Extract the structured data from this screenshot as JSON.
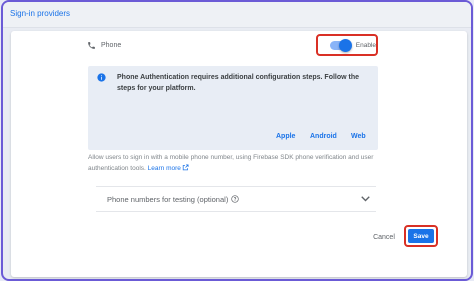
{
  "header": {
    "title": "Sign-in providers"
  },
  "provider": {
    "name": "Phone",
    "icon": "phone-icon"
  },
  "enable_toggle": {
    "label": "Enable",
    "state": "on"
  },
  "info": {
    "icon": "info-icon",
    "text": "Phone Authentication requires additional configuration steps. Follow the steps for your platform.",
    "links": {
      "apple": "Apple",
      "android": "Android",
      "web": "Web"
    }
  },
  "description": {
    "text": "Allow users to sign in with a mobile phone number, using Firebase SDK phone verification and user authentication tools.",
    "learn_more": "Learn more"
  },
  "testing_section": {
    "label": "Phone numbers for testing (optional)"
  },
  "actions": {
    "cancel": "Cancel",
    "save": "Save"
  },
  "colors": {
    "accent": "#1a73e8",
    "highlight": "#d93025",
    "frame": "#6b5bd6"
  }
}
